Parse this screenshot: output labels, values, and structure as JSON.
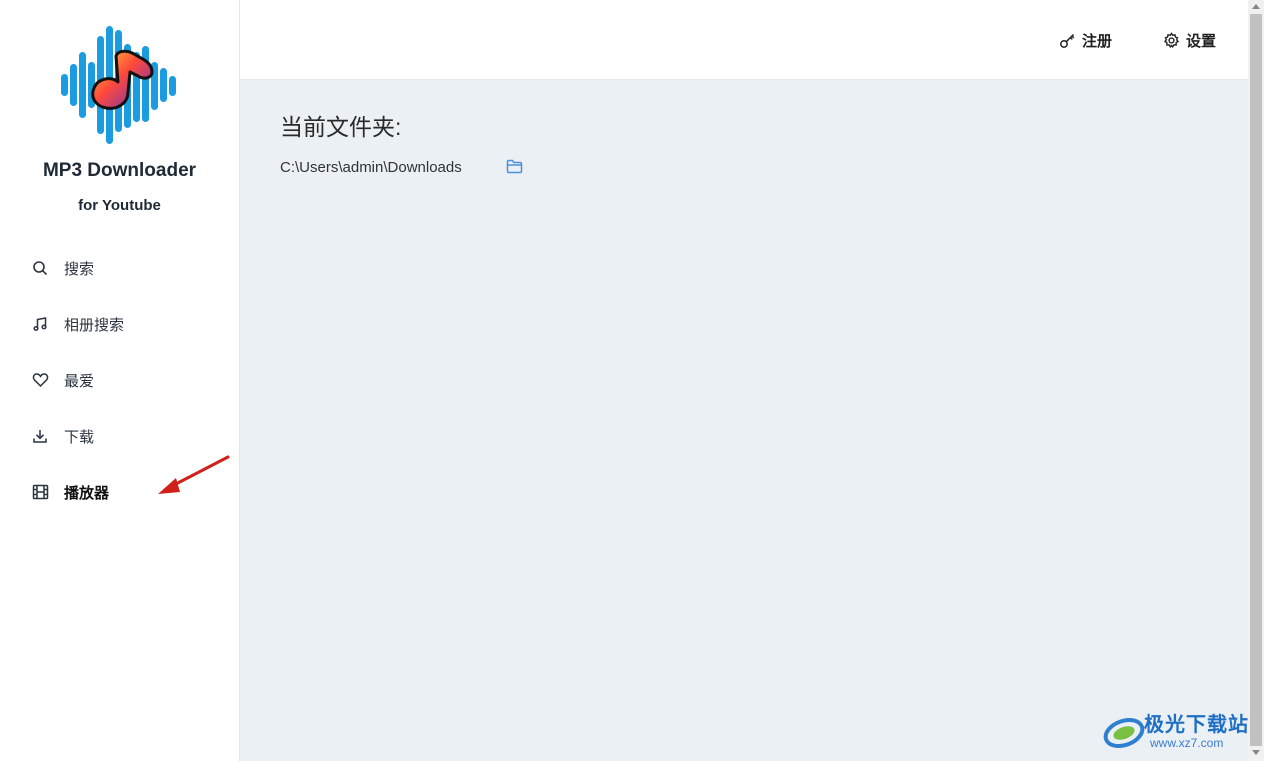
{
  "brand": {
    "title": "MP3 Downloader",
    "subtitle": "for Youtube"
  },
  "sidebar": {
    "items": [
      {
        "label": "搜索",
        "icon": "search-icon"
      },
      {
        "label": "相册搜索",
        "icon": "music-note-icon"
      },
      {
        "label": "最爱",
        "icon": "heart-icon"
      },
      {
        "label": "下载",
        "icon": "download-icon"
      },
      {
        "label": "播放器",
        "icon": "film-icon",
        "active": true
      }
    ]
  },
  "header": {
    "register_label": "注册",
    "settings_label": "设置"
  },
  "main": {
    "folder_heading": "当前文件夹:",
    "folder_path": "C:\\Users\\admin\\Downloads"
  },
  "watermark": {
    "text": "极光下载站",
    "url": "www.xz7.com"
  },
  "colors": {
    "accent": "#4a90d9",
    "main_bg": "#ebf0f5",
    "annotation": "#d0201a"
  }
}
